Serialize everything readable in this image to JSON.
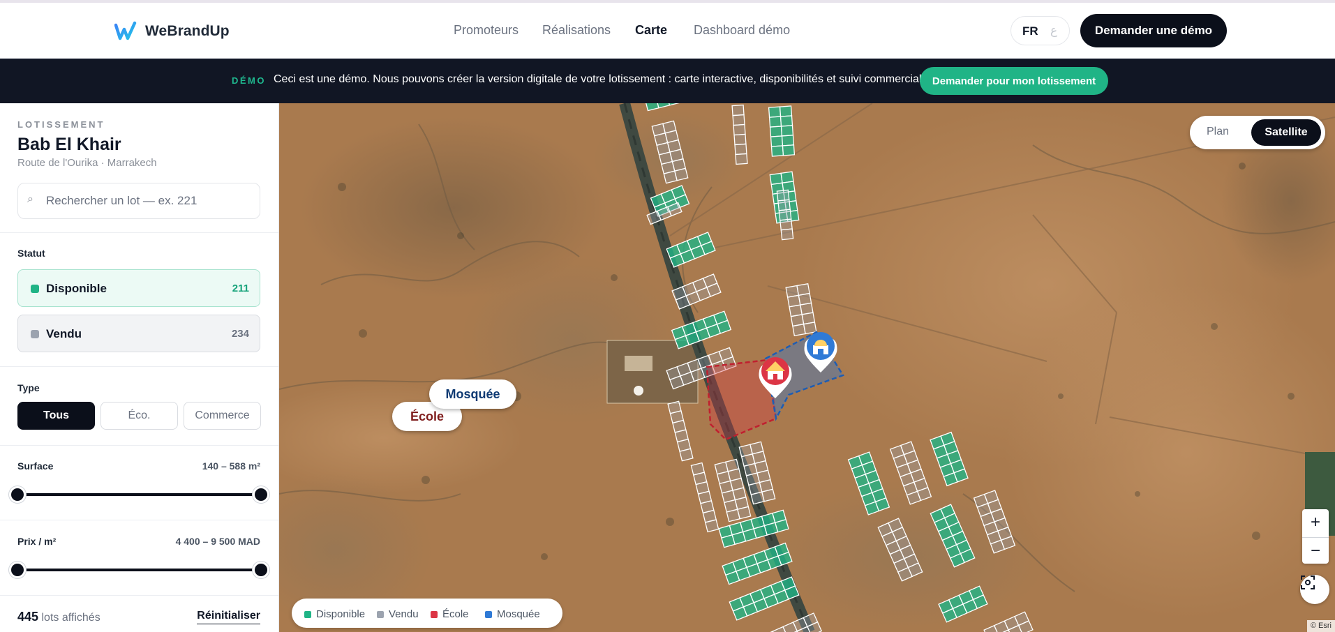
{
  "header": {
    "brand": "WeBrandUp",
    "nav": [
      {
        "label": "Promoteurs",
        "active": false
      },
      {
        "label": "Réalisations",
        "active": false
      },
      {
        "label": "Carte",
        "active": true
      },
      {
        "label": "Dashboard démo",
        "active": false
      }
    ],
    "lang": {
      "fr": "FR",
      "ar": "ع"
    },
    "demo_button": "Demander une démo"
  },
  "banner": {
    "tag": "DÉMO",
    "message": "Ceci est une démo. Nous pouvons créer la version digitale de votre lotissement : carte interactive, disponibilités et suivi commercial.",
    "cta": "Demander pour mon lotissement"
  },
  "sidebar": {
    "eyebrow": "LOTISSEMENT",
    "title": "Bab El Khair",
    "subtitle": "Route de l'Ourika · Marrakech",
    "search_placeholder": "Rechercher un lot — ex. 221",
    "status": {
      "label": "Statut",
      "items": [
        {
          "label": "Disponible",
          "count": "211",
          "color": "#20b486",
          "active": true
        },
        {
          "label": "Vendu",
          "count": "234",
          "color": "#9ca3af",
          "active": false
        }
      ]
    },
    "type": {
      "label": "Type",
      "options": [
        {
          "label": "Tous",
          "active": true
        },
        {
          "label": "Éco.",
          "active": false
        },
        {
          "label": "Commerce",
          "active": false
        }
      ]
    },
    "surface": {
      "label": "Surface",
      "range_text": "140 – 588 m²",
      "min": 140,
      "max": 588,
      "selected_min": 140,
      "selected_max": 588
    },
    "price": {
      "label": "Prix / m²",
      "range_text": "4 400 – 9 500 MAD",
      "min": 4400,
      "max": 9500,
      "selected_min": 4400,
      "selected_max": 9500
    },
    "count": {
      "value": "445",
      "suffix": "lots affichés"
    },
    "reset": "Réinitialiser"
  },
  "map": {
    "toggle": {
      "plan": "Plan",
      "satellite": "Satellite",
      "active": "satellite"
    },
    "zoom_in": "+",
    "zoom_out": "−",
    "attribution": "© Esri",
    "poi": [
      {
        "name": "École",
        "color": "#dc3545",
        "text_color": "#7f1d1d"
      },
      {
        "name": "Mosquée",
        "color": "#2f7ad6",
        "text_color": "#0f3a73"
      }
    ],
    "legend": [
      {
        "label": "Disponible",
        "color": "#20b486"
      },
      {
        "label": "Vendu",
        "color": "#9ca3af"
      },
      {
        "label": "École",
        "color": "#dc3545"
      },
      {
        "label": "Mosquée",
        "color": "#2f7ad6"
      }
    ]
  },
  "colors": {
    "accent": "#20b486",
    "dark": "#0b0f1a",
    "banner": "#111624"
  }
}
